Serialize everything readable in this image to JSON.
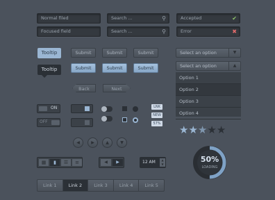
{
  "inputs": {
    "normal": "Normal filed",
    "focused": "Focused field",
    "search1": "Search ...",
    "search2": "Search ...",
    "accepted": "Accepted",
    "error": "Error"
  },
  "tooltips": {
    "light": "Tooltip",
    "dark": "Tooltip"
  },
  "buttons": {
    "submit": "Submit",
    "back": "Back",
    "next": "Next"
  },
  "select": {
    "placeholder": "Select an option",
    "options": [
      "Option 1",
      "Option 2",
      "Option 3",
      "Option 4"
    ]
  },
  "toggles": {
    "on": "ON",
    "off": "OFF"
  },
  "badges": [
    "LNK",
    "NEW",
    "57%"
  ],
  "rating": {
    "value": 2.5,
    "max": 5
  },
  "time": {
    "value": "12 AM"
  },
  "progress": {
    "label": "50%",
    "sub": "LOADING",
    "value": 0.5
  },
  "tabs": [
    "Link 1",
    "Link 2",
    "Link 3",
    "Link 4",
    "Link 5"
  ],
  "colors": {
    "accent": "#9ab6d3",
    "error": "#e06a6a",
    "ok": "#8ec46a"
  }
}
